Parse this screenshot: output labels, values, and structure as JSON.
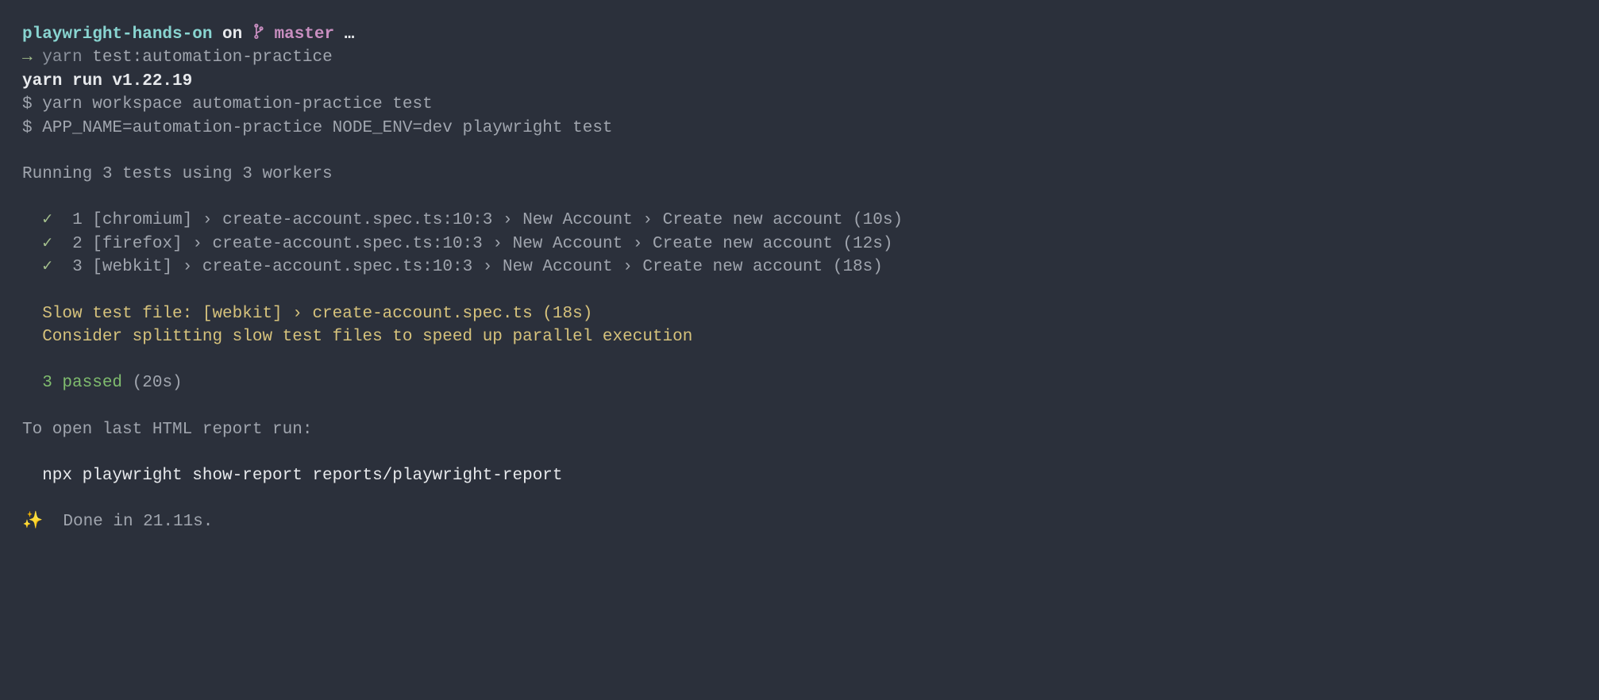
{
  "prompt": {
    "dir": "playwright-hands-on",
    "on": " on ",
    "branch": "master",
    "ellipsis": " …",
    "arrow": "→ ",
    "cmd_tool": "yarn",
    "cmd_args": " test:automation-practice"
  },
  "out": {
    "yarn_run": "yarn run v1.22.19",
    "ws_cmd": "$ yarn workspace automation-practice test",
    "env_cmd": "$ APP_NAME=automation-practice NODE_ENV=dev playwright test",
    "running": "Running 3 tests using 3 workers",
    "tests": [
      {
        "mark": "✓",
        "idx": "1",
        "body": " [chromium] › create-account.spec.ts:10:3 › New Account › Create new account (10s)"
      },
      {
        "mark": "✓",
        "idx": "2",
        "body": " [firefox] › create-account.spec.ts:10:3 › New Account › Create new account (12s)"
      },
      {
        "mark": "✓",
        "idx": "3",
        "body": " [webkit] › create-account.spec.ts:10:3 › New Account › Create new account (18s)"
      }
    ],
    "slow_file": "  Slow test file: [webkit] › create-account.spec.ts (18s)",
    "slow_hint": "  Consider splitting slow test files to speed up parallel execution",
    "passed": "  3 passed",
    "passed_time": " (20s)",
    "report_msg": "To open last HTML report run:",
    "report_cmd": "  npx playwright show-report reports/playwright-report",
    "done_icon": "✨",
    "done_text": "  Done in 21.11s."
  }
}
